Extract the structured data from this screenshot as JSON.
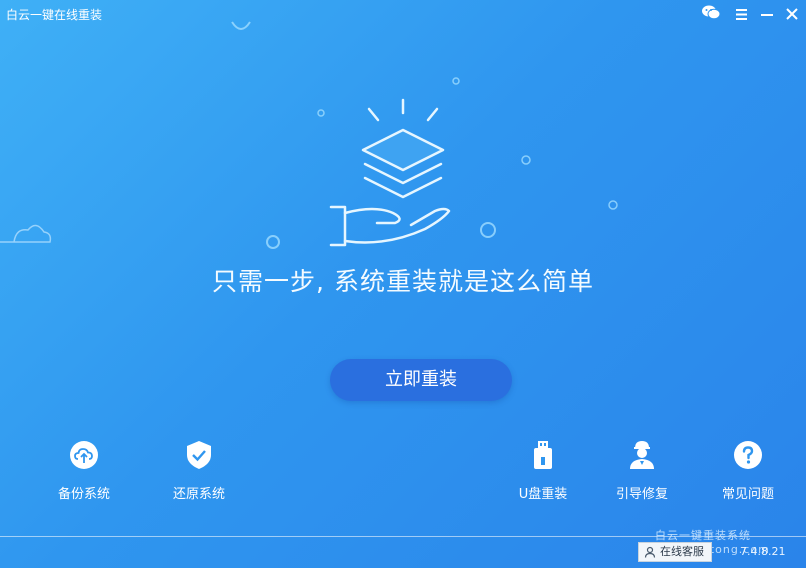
{
  "window": {
    "title": "白云一键在线重装"
  },
  "hero": {
    "tagline": "只需一步, 系统重装就是这么简单"
  },
  "primary_action": {
    "label": "立即重装"
  },
  "tools": [
    {
      "label": "备份系统",
      "icon": "cloud-upload-icon"
    },
    {
      "label": "还原系统",
      "icon": "shield-check-icon"
    },
    {
      "label": "U盘重装",
      "icon": "usb-drive-icon"
    },
    {
      "label": "引导修复",
      "icon": "technician-icon"
    },
    {
      "label": "常见问题",
      "icon": "question-icon"
    }
  ],
  "footer": {
    "support_label": "在线客服",
    "version": "7.4.8.21",
    "watermark": "白云一键重装系统 baiyunxitong.com"
  },
  "colors": {
    "background": "#2f96ef",
    "primary_button": "#2a6fdf"
  }
}
